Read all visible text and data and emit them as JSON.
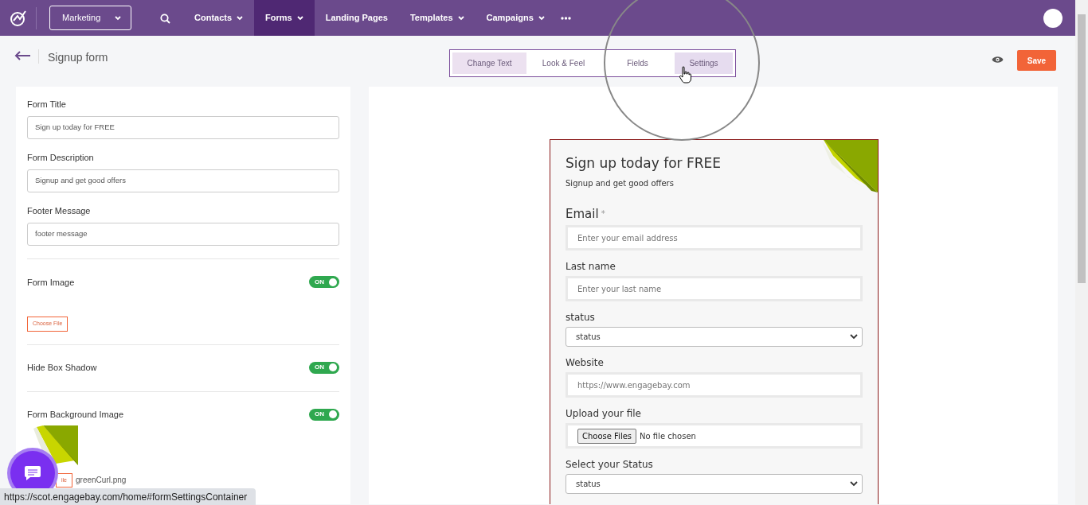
{
  "navbar": {
    "workspace": "Marketing",
    "menu": [
      {
        "label": "Contacts",
        "dropdown": true,
        "selected": false
      },
      {
        "label": "Forms",
        "dropdown": true,
        "selected": true
      },
      {
        "label": "Landing Pages",
        "dropdown": false,
        "selected": false
      },
      {
        "label": "Templates",
        "dropdown": true,
        "selected": false
      },
      {
        "label": "Campaigns",
        "dropdown": true,
        "selected": false
      }
    ]
  },
  "header": {
    "title": "Signup form",
    "tabs": [
      {
        "label": "Change Text",
        "selected": true,
        "hovered": false
      },
      {
        "label": "Look & Feel",
        "selected": false,
        "hovered": false
      },
      {
        "label": "Fields",
        "selected": false,
        "hovered": false
      },
      {
        "label": "Settings",
        "selected": false,
        "hovered": true
      }
    ],
    "save": "Save"
  },
  "settings": {
    "fields": [
      {
        "label": "Form Title",
        "value": "Sign up today for FREE"
      },
      {
        "label": "Form Description",
        "value": "Signup  and get good offers"
      },
      {
        "label": "Footer Message",
        "value": "footer message"
      }
    ],
    "toggles": [
      {
        "label": "Form Image",
        "on": true,
        "state_text": "ON",
        "file_button": "Choose File"
      },
      {
        "label": "Hide Box Shadow",
        "on": true,
        "state_text": "ON"
      },
      {
        "label": "Form Background Image",
        "on": true,
        "state_text": "ON",
        "file_button": "ile",
        "file_name": "greenCurl.png"
      }
    ]
  },
  "preview": {
    "title": "Sign up today for FREE",
    "description": "Signup  and get good offers",
    "fields": [
      {
        "kind": "input",
        "label": "Email",
        "required_mark": "*",
        "placeholder": "Enter your email address"
      },
      {
        "kind": "input",
        "label": "Last name",
        "placeholder": "Enter your last name"
      },
      {
        "kind": "select",
        "label": "status",
        "value": "status"
      },
      {
        "kind": "input",
        "label": "Website",
        "placeholder": "https://www.engagebay.com"
      },
      {
        "kind": "file",
        "label": "Upload your file",
        "button": "Choose Files",
        "value": "No file chosen"
      },
      {
        "kind": "select",
        "label": "Select your Status",
        "value": "status"
      }
    ]
  },
  "status_bar": {
    "url": "https://scot.engagebay.com/home#formSettingsContainer"
  }
}
